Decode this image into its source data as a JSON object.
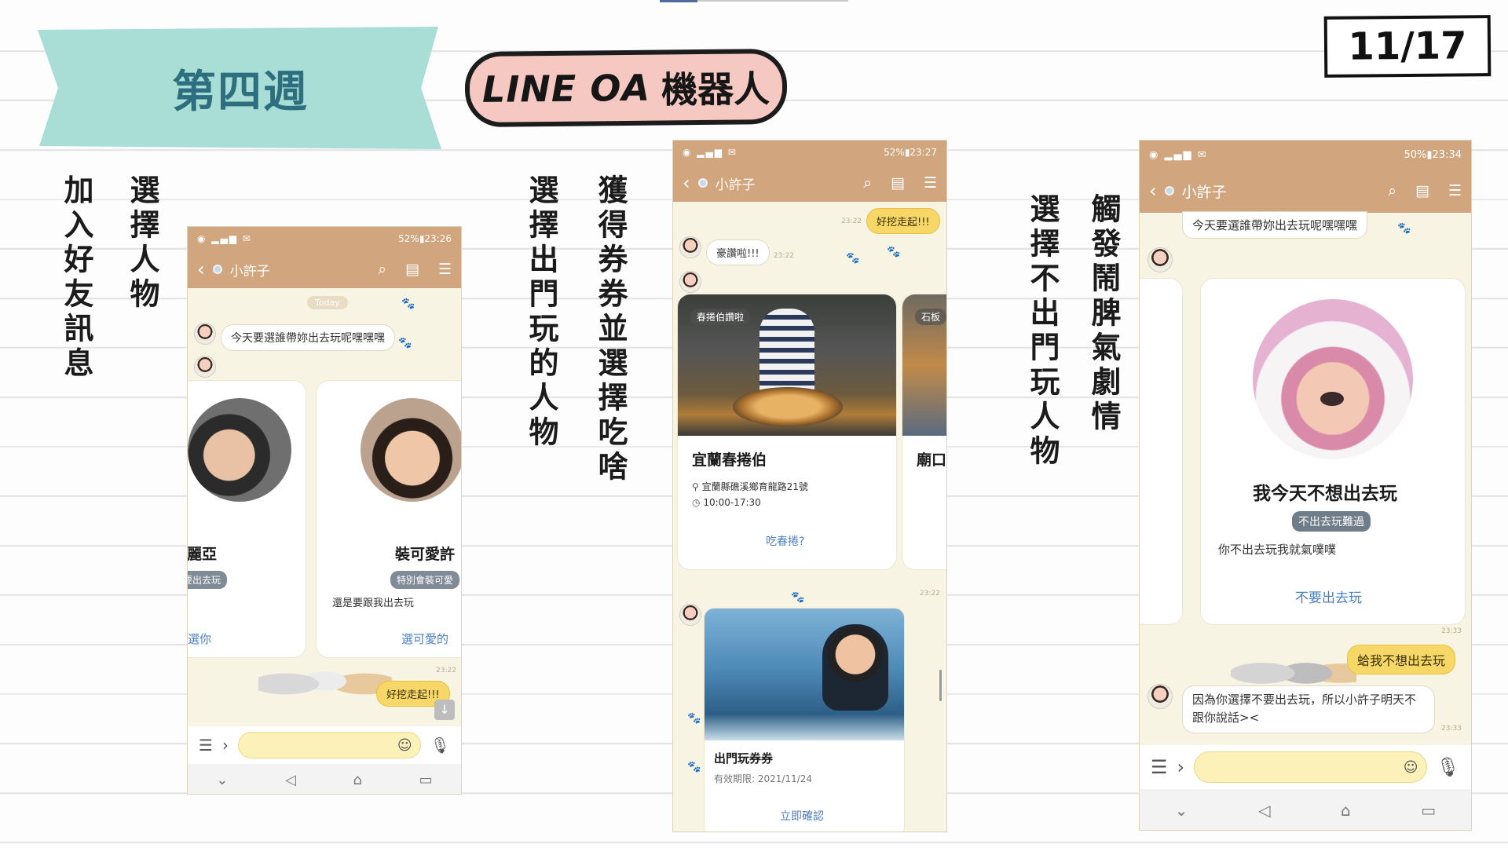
{
  "slide": {
    "week_label": "第四週",
    "bot_title_en": "LINE OA",
    "bot_title_zh": "機器人",
    "page_number": "11/17"
  },
  "captions": {
    "c1": "加入好友訊息",
    "c2": "選擇人物",
    "c3": "選擇出門玩的人物",
    "c4": "獲得券券並選擇吃啥",
    "c5": "選擇不出門玩人物",
    "c6": "觸發鬧脾氣劇情"
  },
  "phone1": {
    "status_time": "52%▮23:26",
    "chat_name": "小許子",
    "today_chip": "Today",
    "welcome_msg": "今天要選誰帶妳出去玩呢嘿嘿嘿",
    "card_left": {
      "name": "瑪麗亞",
      "tag": "不要出去玩",
      "desc": "",
      "link": "選你"
    },
    "card_right": {
      "name": "裝可愛許",
      "tag": "特別會裝可愛",
      "desc": "還是要跟我出去玩",
      "link": "選可愛的"
    },
    "user_msg": "好挖走起!!!",
    "user_msg_time": "23:22"
  },
  "phone2": {
    "status_time": "52%▮23:27",
    "chat_name": "小許子",
    "user_msg": "好挖走起!!!",
    "user_msg_time": "23:22",
    "bot_msg": "豪讚啦!!!",
    "bot_msg_time": "23:22",
    "shop": {
      "label": "春捲伯讚啦",
      "name": "宜蘭春捲伯",
      "address": "宜蘭縣礁溪鄉育龍路21號",
      "hours": "10:00-17:30",
      "action": "吃春捲?"
    },
    "shop2_name": "廟口",
    "shop2_label": "石板",
    "coupon_time": "23:22",
    "coupon": {
      "title": "出門玩券券",
      "validity": "有效期限: 2021/11/24",
      "action": "立即確認"
    }
  },
  "phone3": {
    "status_time": "50%▮23:34",
    "chat_name": "小許子",
    "top_msg": "今天要選誰帶妳出去玩呢嘿嘿嘿",
    "card": {
      "name": "我今天不想出去玩",
      "tag": "不出去玩難過",
      "desc": "你不出去玩我就氣噗噗",
      "link": "不要出去玩"
    },
    "card_time": "23:33",
    "user_msg": "蛤我不想出去玩",
    "bot_reply": "因為你選擇不要出去玩，所以小許子明天不跟你說話><",
    "bot_reply_time": "23:33"
  },
  "icons": [
    "back-icon",
    "search-icon",
    "list-icon",
    "menu-icon",
    "emoji-icon",
    "mic-icon",
    "location-icon",
    "clock-icon",
    "paw-icon"
  ],
  "colors": {
    "app_header": "#d1a57d",
    "chat_bg": "#f8f4e4",
    "banner": "#a8ded6",
    "bot_title_bg": "#f6c8c2",
    "link": "#4a7fc3"
  }
}
